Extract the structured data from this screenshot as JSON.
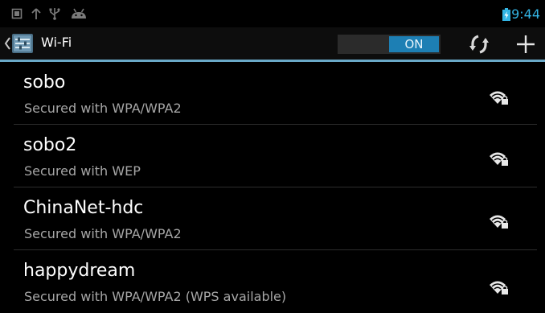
{
  "status_bar": {
    "time": "9:44",
    "notification_icons": [
      "screenshot-icon",
      "upload-icon",
      "usb-icon",
      "android-debug-icon"
    ],
    "battery_icon": "battery-charging-icon",
    "accent_color": "#33b5e5"
  },
  "action_bar": {
    "title": "Wi-Fi",
    "app_icon": "settings-app-icon",
    "toggle_label": "ON",
    "toggle_state": "on",
    "actions": [
      {
        "name": "wps-push-button",
        "icon": "wps-refresh-icon"
      },
      {
        "name": "add-network-button",
        "icon": "plus-icon"
      }
    ],
    "accent_color": "#1d7fb4"
  },
  "networks": [
    {
      "ssid": "sobo",
      "summary": "Secured with WPA/WPA2",
      "icon": "wifi-locked-icon"
    },
    {
      "ssid": "sobo2",
      "summary": "Secured with WEP",
      "icon": "wifi-locked-icon"
    },
    {
      "ssid": "ChinaNet-hdc",
      "summary": "Secured with WPA/WPA2",
      "icon": "wifi-locked-icon"
    },
    {
      "ssid": "happydream",
      "summary": "Secured with WPA/WPA2 (WPS available)",
      "icon": "wifi-locked-icon"
    }
  ]
}
